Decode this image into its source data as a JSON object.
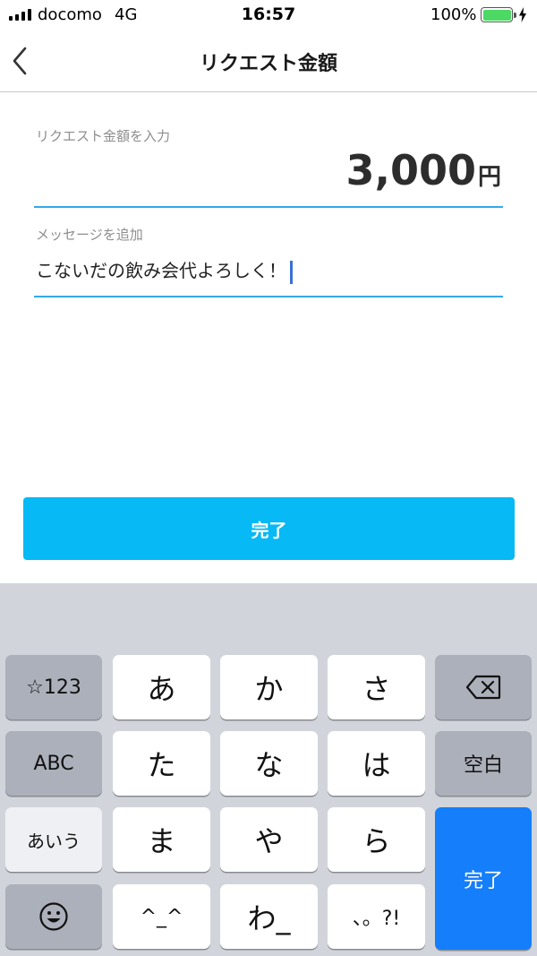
{
  "status_bar": {
    "carrier": "docomo",
    "network": "4G",
    "time": "16:57",
    "battery_percent": "100%",
    "icons": [
      "signal-bars-icon",
      "battery-icon",
      "charging-bolt-icon"
    ]
  },
  "nav": {
    "back_icon": "chevron-left-icon",
    "title": "リクエスト金額"
  },
  "form": {
    "amount_label": "リクエスト金額を入力",
    "amount_value": "3,000",
    "amount_unit": "円",
    "message_label": "メッセージを追加",
    "message_value": "こないだの飲み会代よろしく！"
  },
  "done_button": "完了",
  "colors": {
    "accent_underline": "#35a9e8",
    "button_background": "#07b9f5",
    "keyboard_background": "#d1d5db",
    "keyboard_return": "#157efb"
  },
  "keyboard": {
    "rows": [
      [
        "☆123",
        "あ",
        "か",
        "さ",
        "⌫"
      ],
      [
        "ABC",
        "た",
        "な",
        "は",
        "空白"
      ],
      [
        "あいう",
        "ま",
        "や",
        "ら",
        "完了"
      ],
      [
        "☺",
        "^_^",
        "わ_",
        "、。?!"
      ]
    ],
    "mode_key": "☆123",
    "alpha_key": "ABC",
    "kana_key": "あいう",
    "emoji_icon": "emoji-face-icon",
    "delete_icon": "backspace-icon",
    "space_key": "空白",
    "return_key": "完了",
    "kana": {
      "a": "あ",
      "ka": "か",
      "sa": "さ",
      "ta": "た",
      "na": "な",
      "ha": "は",
      "ma": "ま",
      "ya": "や",
      "ra": "ら",
      "kaomoji": "^_^",
      "wa": "わ_",
      "punct": "、。?!"
    }
  }
}
